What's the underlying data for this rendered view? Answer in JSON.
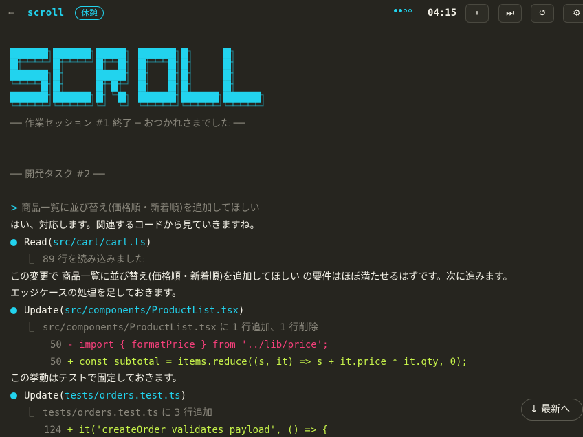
{
  "header": {
    "back_glyph": "←",
    "app_title": "scroll",
    "mode_badge": "休憩",
    "timer": "04:15",
    "pomodoro_dots": [
      true,
      true,
      false,
      false
    ],
    "buttons": {
      "pause": "⏸",
      "skip": "⏭",
      "restart": "↺",
      "settings": "⚙"
    }
  },
  "logo": {
    "letters": [
      "S",
      "C",
      "R",
      "O",
      "L",
      "L"
    ],
    "color": "#22d3ee"
  },
  "session": {
    "ended": "── 作業セッション #1 終了 ─ おつかれさまでした ──",
    "task": "── 開発タスク #2 ──"
  },
  "transcript": {
    "prompt_marker": ">",
    "prompt": " 商品一覧に並び替え(価格順・新着順)を追加してほしい",
    "reply1": "はい、対応します。関連するコードから見ていきますね。",
    "read_tool": "Read",
    "read_path": "src/cart/cart.ts",
    "read_result": "89 行を読み込みました",
    "reply2": "この変更で 商品一覧に並び替え(価格順・新着順)を追加してほしい の要件はほぼ満たせるはずです。次に進みます。",
    "reply3": "エッジケースの処理を足しておきます。",
    "update1_tool": "Update",
    "update1_path": "src/components/ProductList.tsx",
    "update1_summary_path": "src/components/ProductList.tsx",
    "update1_summary_text": " に 1 行追加、1 行削除",
    "diff": [
      {
        "lineno": "50",
        "text": " - import { formatPrice } from '../lib/price';",
        "kind": "removed"
      },
      {
        "lineno": "50",
        "text": " + const subtotal = items.reduce((s, it) => s + it.price * it.qty, 0);",
        "kind": "added"
      }
    ],
    "reply4": "この挙動はテストで固定しておきます。",
    "update2_tool": "Update",
    "update2_path": "tests/orders.test.ts",
    "update2_summary_path": "tests/orders.test.ts",
    "update2_summary_text": " に 3 行追加",
    "diff2_partial": {
      "lineno": "124",
      "text": " + it('createOrder validates payload', () => {"
    }
  },
  "jump_latest": "↓ 最新へ"
}
